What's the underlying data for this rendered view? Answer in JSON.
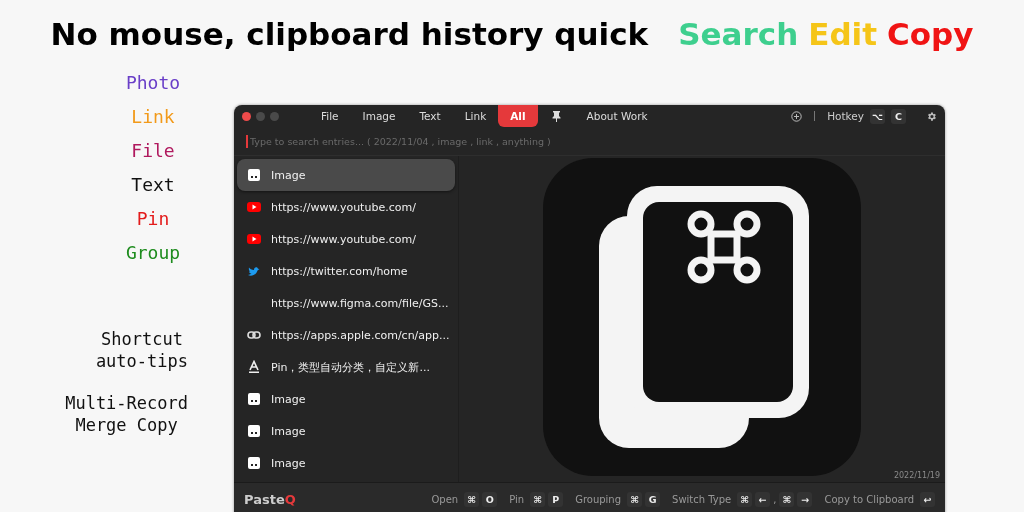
{
  "headline": {
    "text": "No mouse, clipboard history quick",
    "words": [
      {
        "text": "Search",
        "color": "#3ecf8e"
      },
      {
        "text": "Edit",
        "color": "#f5c518"
      },
      {
        "text": "Copy",
        "color": "#f01414"
      }
    ]
  },
  "features": [
    {
      "text": "Photo",
      "color": "#6a3fc8"
    },
    {
      "text": "Link",
      "color": "#f29a1a"
    },
    {
      "text": "File",
      "color": "#b0195e"
    },
    {
      "text": "Text",
      "color": "#111111"
    },
    {
      "text": "Pin",
      "color": "#e31b1b"
    },
    {
      "text": "Group",
      "color": "#1e8c1e"
    }
  ],
  "notes": [
    "Shortcut\nauto-tips",
    "Multi-Record\nMerge Copy"
  ],
  "window": {
    "tabs": [
      {
        "label": "File",
        "selected": false
      },
      {
        "label": "Image",
        "selected": false
      },
      {
        "label": "Text",
        "selected": false
      },
      {
        "label": "Link",
        "selected": false
      },
      {
        "label": "All",
        "selected": true
      }
    ],
    "about": "About Work",
    "hotkey": {
      "label": "Hotkey",
      "keys": [
        "⌥",
        "C"
      ]
    },
    "search": {
      "placeholder": "Type to search entries... ( 2022/11/04 , image , link , anything )"
    },
    "entries": [
      {
        "kind": "image",
        "text": "Image",
        "selected": true
      },
      {
        "kind": "youtube",
        "text": "https://www.youtube.com/",
        "selected": false
      },
      {
        "kind": "youtube",
        "text": "https://www.youtube.com/",
        "selected": false
      },
      {
        "kind": "twitter",
        "text": "https://twitter.com/home",
        "selected": false
      },
      {
        "kind": "none",
        "text": "https://www.figma.com/file/GS...",
        "selected": false
      },
      {
        "kind": "link",
        "text": "https://apps.apple.com/cn/app...",
        "selected": false
      },
      {
        "kind": "text",
        "text": "Pin，类型自动分类，自定义新...",
        "selected": false
      },
      {
        "kind": "image",
        "text": "Image",
        "selected": false
      },
      {
        "kind": "image",
        "text": "Image",
        "selected": false
      },
      {
        "kind": "image",
        "text": "Image",
        "selected": false
      }
    ],
    "preview": {
      "date": "2022/11/19"
    },
    "brand": {
      "name": "Paste",
      "accent": "Q"
    },
    "shortcuts": [
      {
        "label": "Open",
        "keys": [
          {
            "kind": "key",
            "text": "⌘"
          },
          {
            "kind": "key",
            "text": "O"
          }
        ]
      },
      {
        "label": "Pin",
        "keys": [
          {
            "kind": "key",
            "text": "⌘"
          },
          {
            "kind": "key",
            "text": "P"
          }
        ]
      },
      {
        "label": "Grouping",
        "keys": [
          {
            "kind": "key",
            "text": "⌘"
          },
          {
            "kind": "key",
            "text": "G"
          }
        ]
      },
      {
        "label": "Switch Type",
        "keys": [
          {
            "kind": "key",
            "text": "⌘"
          },
          {
            "kind": "key",
            "text": "←"
          },
          {
            "kind": "sep",
            "text": ","
          },
          {
            "kind": "key",
            "text": "⌘"
          },
          {
            "kind": "key",
            "text": "→"
          }
        ]
      },
      {
        "label": "Copy to Clipboard",
        "keys": [
          {
            "kind": "key",
            "text": "↩"
          }
        ]
      }
    ]
  }
}
